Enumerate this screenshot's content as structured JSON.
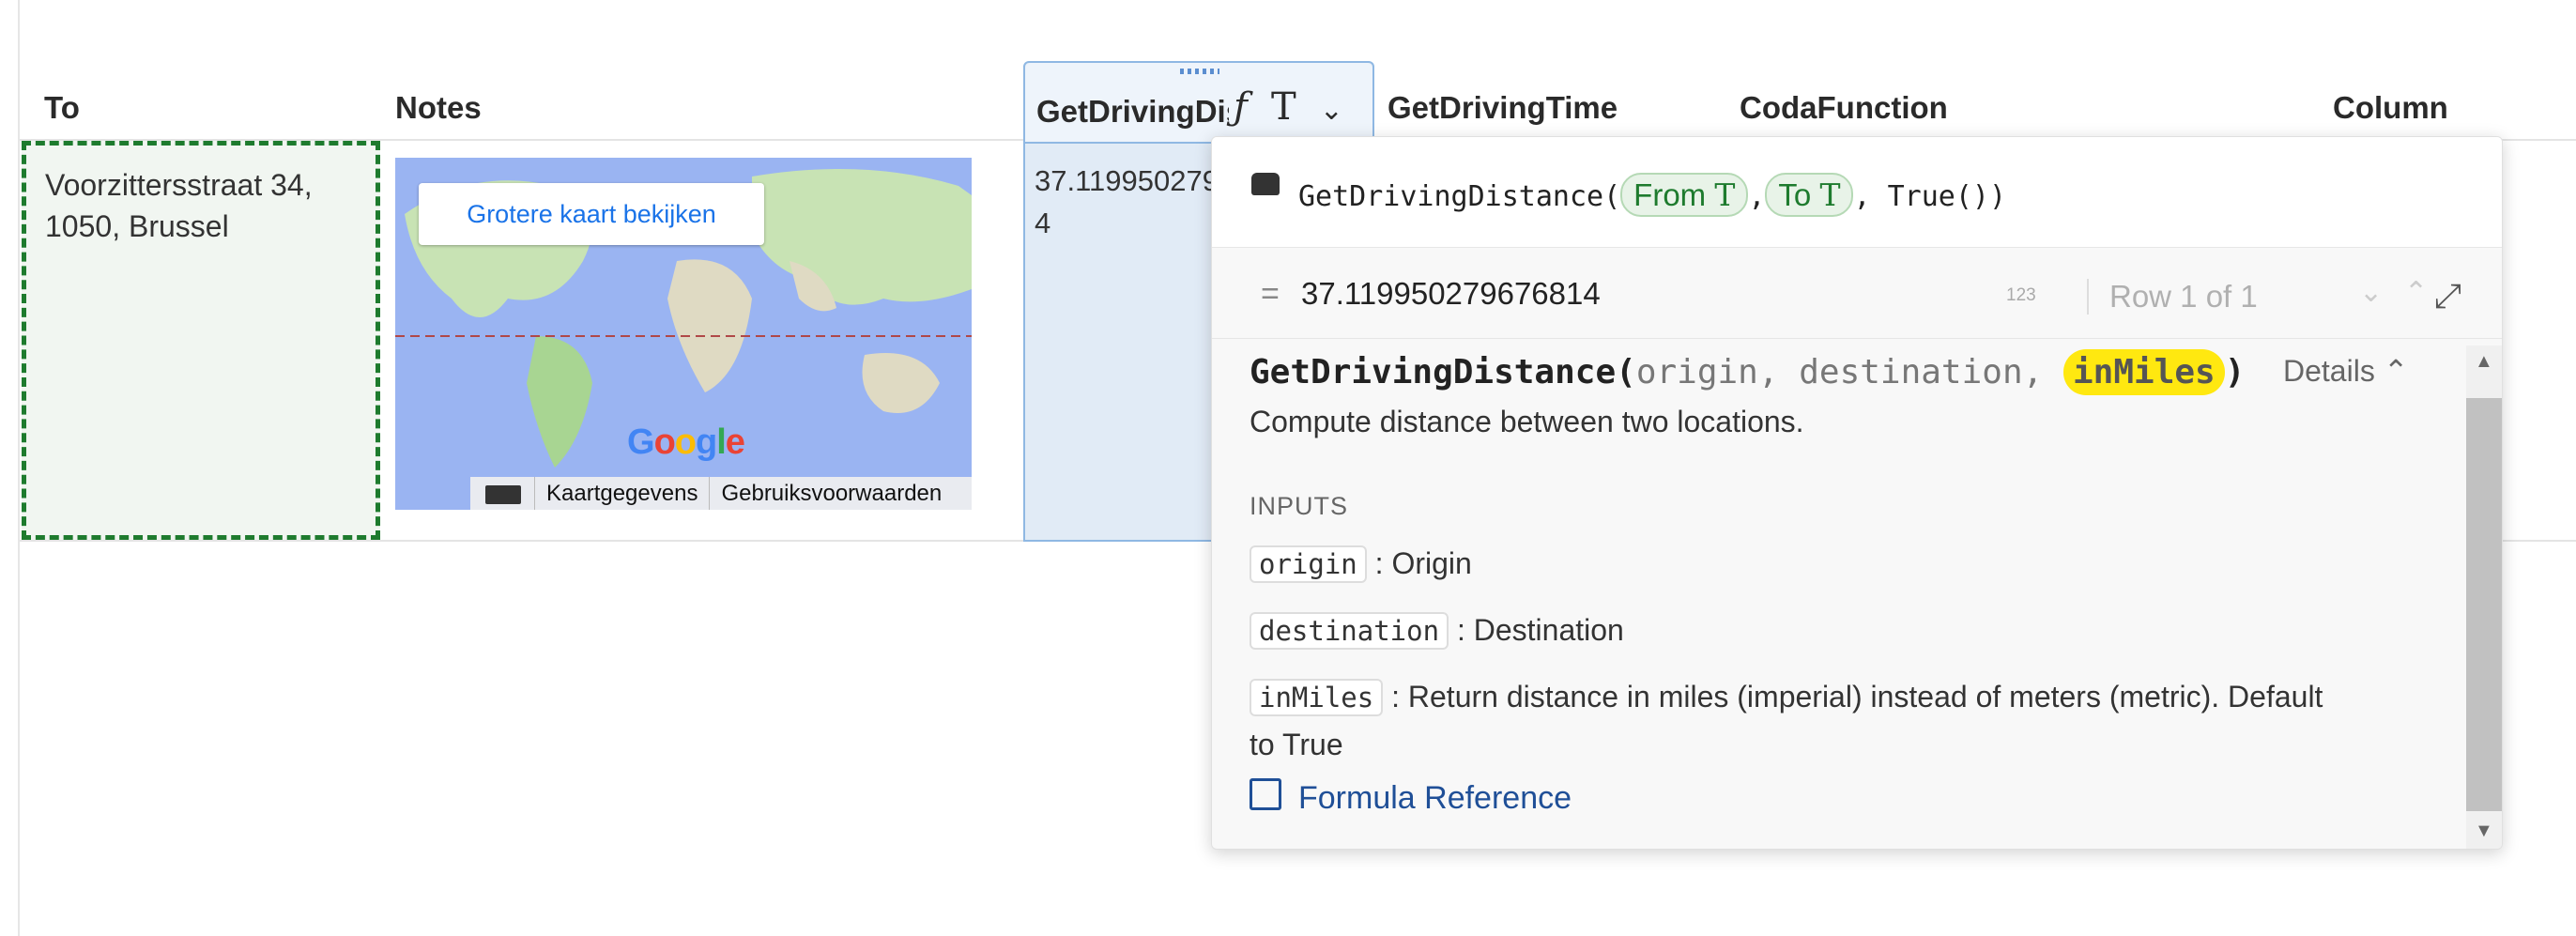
{
  "table": {
    "columns": {
      "to": "To",
      "notes": "Notes",
      "driving_distance": "GetDrivingDistance",
      "driving_time": "GetDrivingTime",
      "coda_function": "CodaFunction",
      "column": "Column"
    },
    "row1": {
      "to_line1": "Voorzittersstraat 34,",
      "to_line2": "1050, Brussel",
      "distance_line1": "37.119950279676814",
      "distance_line2": "4"
    }
  },
  "map": {
    "button_label": "Grotere kaart bekijken",
    "logo_text": "Google",
    "footer_data": "Kaartgegevens",
    "footer_terms": "Gebruiksvoorwaarden"
  },
  "header_icons": {
    "formula_icon": "ƒ",
    "text_icon": "T",
    "chevron": "⌄"
  },
  "popup": {
    "formula_prefix": "GetDrivingDistance(",
    "arg1": "From",
    "arg2": "To",
    "formula_suffix": ", True())",
    "type_glyph": "T",
    "result_eq": "=",
    "result_value": "37.119950279676814",
    "type_badge": "123",
    "row_info": "Row 1 of 1",
    "signature_name": "GetDrivingDistance(",
    "param_origin": "origin",
    "param_destination": "destination",
    "param_inmiles": "inMiles",
    "description": "Compute distance between two locations.",
    "details_label": "Details",
    "inputs_heading": "INPUTS",
    "input_origin_desc": ": Origin",
    "input_destination_desc": ": Destination",
    "input_inmiles_desc_1": ": Return distance in miles (imperial) instead of meters (metric). Default",
    "input_inmiles_desc_2": "to True",
    "reference_link": "Formula Reference"
  },
  "colors": {
    "selection_green": "#1e7b2e",
    "active_column_blue": "#e1ebf6",
    "highlight_yellow": "#ffe810",
    "link_blue": "#1f4f97"
  }
}
